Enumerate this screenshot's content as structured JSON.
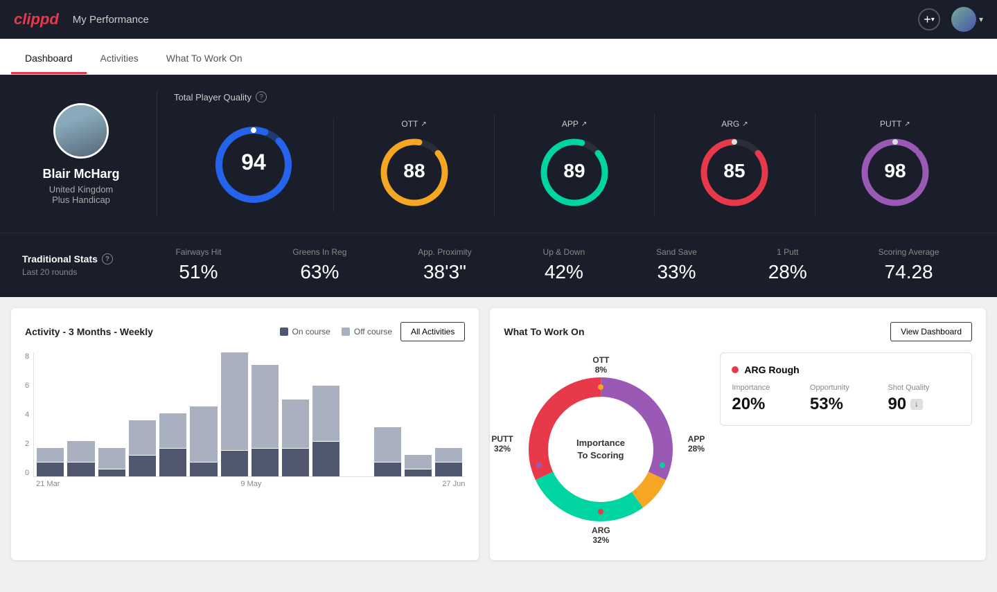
{
  "app": {
    "logo": "clippd",
    "nav_title": "My Performance"
  },
  "tabs": [
    {
      "id": "dashboard",
      "label": "Dashboard",
      "active": true
    },
    {
      "id": "activities",
      "label": "Activities",
      "active": false
    },
    {
      "id": "what_to_work_on",
      "label": "What To Work On",
      "active": false
    }
  ],
  "player": {
    "name": "Blair McHarg",
    "country": "United Kingdom",
    "handicap": "Plus Handicap"
  },
  "quality": {
    "label": "Total Player Quality",
    "main_score": "94",
    "categories": [
      {
        "id": "ott",
        "label": "OTT",
        "score": "88",
        "color_start": "#f5a623",
        "color_end": "#f5a623",
        "track": "#2a2e3a"
      },
      {
        "id": "app",
        "label": "APP",
        "score": "89",
        "color_start": "#00d4a0",
        "color_end": "#00d4a0",
        "track": "#2a2e3a"
      },
      {
        "id": "arg",
        "label": "ARG",
        "score": "85",
        "color_start": "#e8394a",
        "color_end": "#e8394a",
        "track": "#2a2e3a"
      },
      {
        "id": "putt",
        "label": "PUTT",
        "score": "98",
        "color_start": "#9b59b6",
        "color_end": "#9b59b6",
        "track": "#2a2e3a"
      }
    ]
  },
  "traditional_stats": {
    "title": "Traditional Stats",
    "subtitle": "Last 20 rounds",
    "items": [
      {
        "label": "Fairways Hit",
        "value": "51%"
      },
      {
        "label": "Greens In Reg",
        "value": "63%"
      },
      {
        "label": "App. Proximity",
        "value": "38'3\""
      },
      {
        "label": "Up & Down",
        "value": "42%"
      },
      {
        "label": "Sand Save",
        "value": "33%"
      },
      {
        "label": "1 Putt",
        "value": "28%"
      },
      {
        "label": "Scoring Average",
        "value": "74.28"
      }
    ]
  },
  "activity_chart": {
    "title": "Activity - 3 Months - Weekly",
    "legend_on": "On course",
    "legend_off": "Off course",
    "btn_label": "All Activities",
    "y_labels": [
      "8",
      "6",
      "4",
      "2",
      "0"
    ],
    "x_labels": [
      "21 Mar",
      "9 May",
      "27 Jun"
    ],
    "bars": [
      {
        "on": 1,
        "off": 1
      },
      {
        "on": 1,
        "off": 1.5
      },
      {
        "on": 0.5,
        "off": 1.5
      },
      {
        "on": 1.5,
        "off": 2.5
      },
      {
        "on": 2,
        "off": 2.5
      },
      {
        "on": 1,
        "off": 4
      },
      {
        "on": 2,
        "off": 7.5
      },
      {
        "on": 2,
        "off": 6
      },
      {
        "on": 2,
        "off": 3.5
      },
      {
        "on": 2.5,
        "off": 4
      },
      {
        "on": 0,
        "off": 0
      },
      {
        "on": 1,
        "off": 2.5
      },
      {
        "on": 0.5,
        "off": 1
      },
      {
        "on": 1,
        "off": 1
      }
    ]
  },
  "what_to_work_on": {
    "title": "What To Work On",
    "btn_label": "View Dashboard",
    "donut_center_line1": "Importance",
    "donut_center_line2": "To Scoring",
    "segments": [
      {
        "label": "OTT",
        "pct": "8%",
        "color": "#f5a623"
      },
      {
        "label": "APP",
        "pct": "28%",
        "color": "#00d4a0"
      },
      {
        "label": "ARG",
        "pct": "32%",
        "color": "#e8394a"
      },
      {
        "label": "PUTT",
        "pct": "32%",
        "color": "#9b59b6"
      }
    ],
    "detail_card": {
      "category": "ARG Rough",
      "dot_color": "#e8394a",
      "metrics": [
        {
          "label": "Importance",
          "value": "20%"
        },
        {
          "label": "Opportunity",
          "value": "53%"
        },
        {
          "label": "Shot Quality",
          "value": "90",
          "badge": "↓"
        }
      ]
    }
  },
  "icons": {
    "help": "?",
    "arrow_up": "↗",
    "plus": "+",
    "chevron_down": "▾"
  }
}
